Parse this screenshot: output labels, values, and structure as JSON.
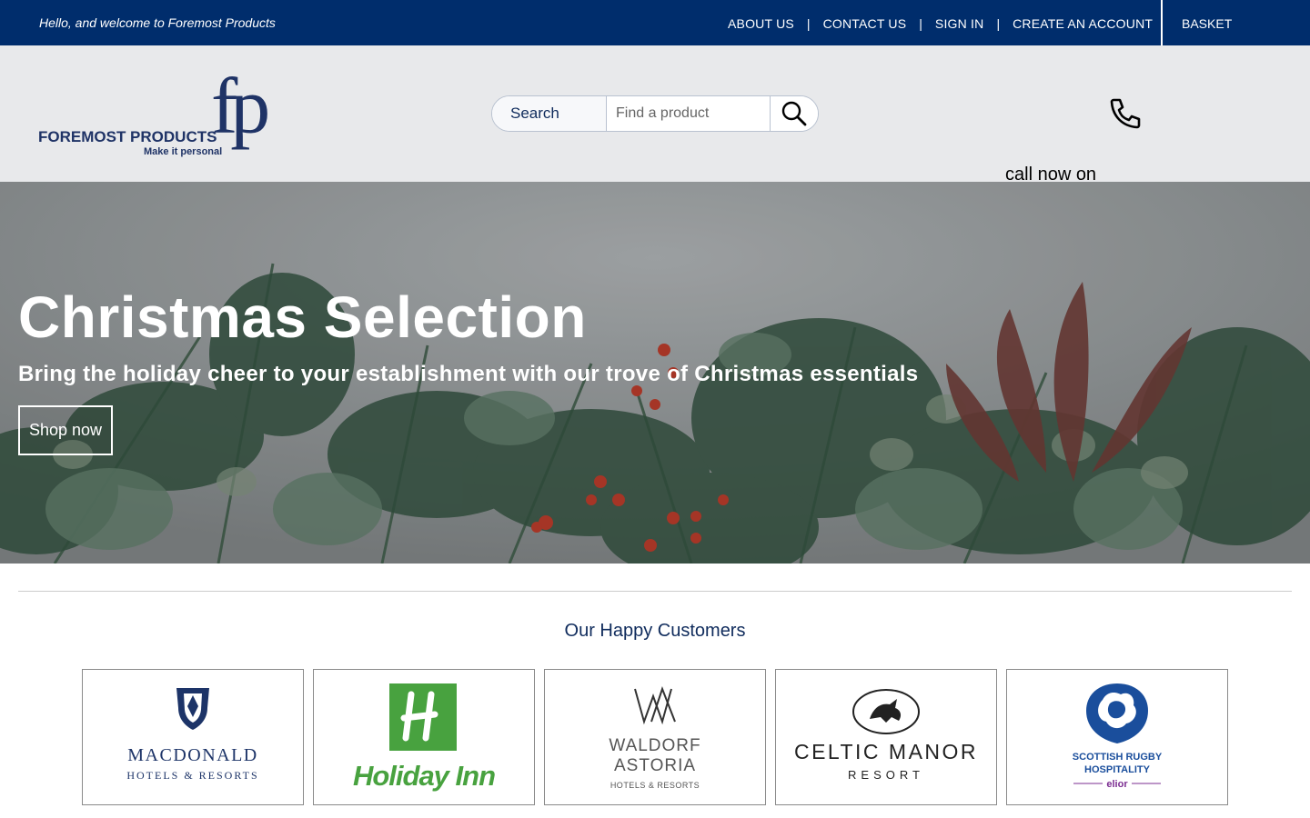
{
  "topbar": {
    "welcome": "Hello, and welcome to Foremost Products",
    "links": [
      "ABOUT US",
      "CONTACT US",
      "SIGN IN",
      "CREATE AN ACCOUNT"
    ],
    "separator": "|",
    "basket": "BASKET",
    "background": "#002d6c"
  },
  "header": {
    "logo": {
      "name": "FOREMOST PRODUCTS",
      "tagline": "Make it personal",
      "monogram": "fp"
    },
    "search": {
      "label": "Search",
      "placeholder": "Find a product",
      "button_icon": "search-icon"
    },
    "phone_icon": "phone-icon",
    "call_text": "call now on",
    "background": "#e8e9eb"
  },
  "hero": {
    "title": "Christmas Selection",
    "subtitle": "Bring the holiday cheer to your establishment with our trove of Christmas essentials",
    "button": "Shop now"
  },
  "customers": {
    "title": "Our Happy Customers",
    "logos": [
      {
        "line1": "MACDONALD",
        "line2": "HOTELS & RESORTS"
      },
      {
        "line1": "Holiday Inn"
      },
      {
        "line1": "WALDORF",
        "line2": "ASTORIA",
        "line3": "HOTELS & RESORTS"
      },
      {
        "line1": "CELTIC MANOR",
        "line2": "RESORT"
      },
      {
        "line1": "SCOTTISH RUGBY",
        "line2": "HOSPITALITY",
        "line3": "elior"
      }
    ]
  },
  "colors": {
    "navy": "#002d6c",
    "logo_blue": "#1f3366",
    "holiday_green": "#48a23f",
    "elior_purple": "#7b2d91"
  }
}
